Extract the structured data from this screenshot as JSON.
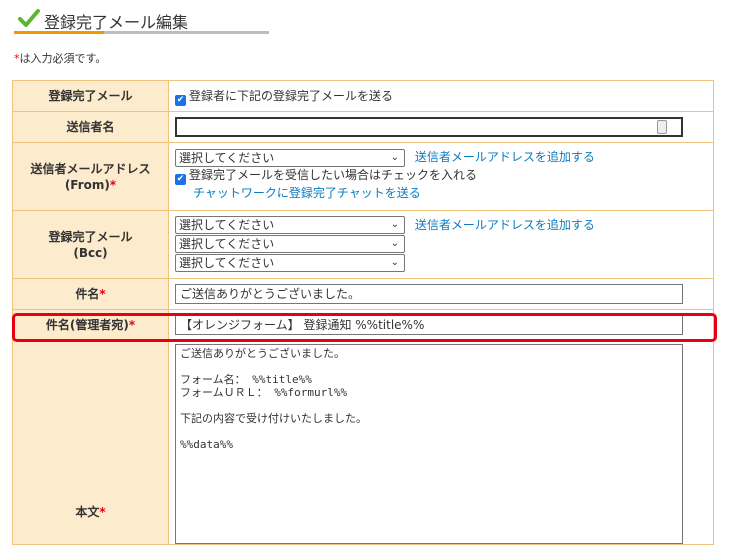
{
  "page": {
    "title": "登録完了メール編集",
    "required_note_mark": "*",
    "required_note_text": "は入力必須です。"
  },
  "form": {
    "req_mark": "*",
    "rows": {
      "notify": {
        "label": "登録完了メール",
        "checkbox_label": "登録者に下記の登録完了メールを送る",
        "checked": true
      },
      "sender_name": {
        "label": "送信者名",
        "value": ""
      },
      "sender_from": {
        "label_line1": "送信者メールアドレス",
        "label_line2": "(From)",
        "select_value": "選択してください",
        "add_link": "送信者メールアドレスを追加する",
        "checkbox_label": "登録完了メールを受信したい場合はチェックを入れる",
        "checked": true,
        "chatwork_link": "チャットワークに登録完了チャットを送る"
      },
      "bcc": {
        "label_line1": "登録完了メール",
        "label_line2": "(Bcc)",
        "selects": [
          "選択してください",
          "選択してください",
          "選択してください"
        ],
        "add_link": "送信者メールアドレスを追加する"
      },
      "subject": {
        "label": "件名",
        "value": "ご送信ありがとうございました。"
      },
      "admin_subject": {
        "label": "件名(管理者宛)",
        "value": "【オレンジフォーム】 登録通知 %%title%%"
      },
      "body": {
        "label": "本文",
        "text": "ご送信ありがとうございました。\n\nフォーム名： %%title%%\nフォームＵＲＬ： %%formurl%%\n\n下記の内容で受け付けいたしました。\n\n%%data%%"
      }
    }
  },
  "colors": {
    "header_bg": "#fcebcd",
    "border": "#f0c27b",
    "accent_orange": "#f39800",
    "required_red": "#e60012",
    "link_blue": "#0a7bbf"
  }
}
